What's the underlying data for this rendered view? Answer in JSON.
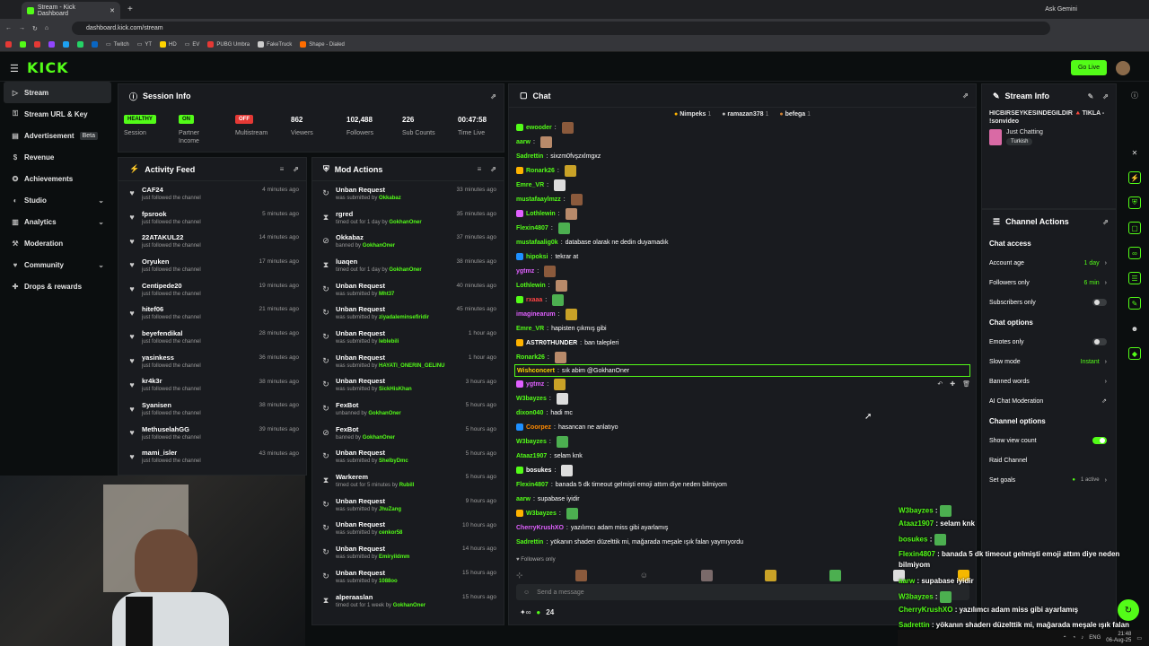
{
  "browser": {
    "tab_title": "Stream - Kick Dashboard",
    "url": "dashboard.kick.com/stream",
    "ask_gemini": "Ask Gemini",
    "bookmarks": [
      "Twitch",
      "YT",
      "HD",
      "EV",
      "PUBG Umbra",
      "FakeTruck",
      "Shape - Dialed"
    ]
  },
  "app": {
    "logo": "KICK",
    "go_live": "Go Live"
  },
  "sidebar": {
    "items": [
      {
        "label": "Stream",
        "icon": "▷"
      },
      {
        "label": "Stream URL & Key",
        "icon": "⚿"
      },
      {
        "label": "Advertisement",
        "icon": "▤",
        "badge": "Beta"
      },
      {
        "label": "Revenue",
        "icon": "$"
      },
      {
        "label": "Achievements",
        "icon": "✪"
      },
      {
        "label": "Studio",
        "icon": "◐",
        "chevron": "⌄"
      },
      {
        "label": "Analytics",
        "icon": "▥",
        "chevron": "⌄"
      },
      {
        "label": "Moderation",
        "icon": "⚒"
      },
      {
        "label": "Community",
        "icon": "♥",
        "chevron": "⌄"
      },
      {
        "label": "Drops & rewards",
        "icon": "✚"
      }
    ]
  },
  "session": {
    "title": "Session Info",
    "stats": [
      {
        "value": "HEALTHY",
        "label": "Session",
        "color": "#53fc18"
      },
      {
        "value": "ON",
        "label": "Partner Income",
        "color": "#53fc18"
      },
      {
        "value": "OFF",
        "label": "Multistream",
        "color": "#e53935"
      },
      {
        "value": "862",
        "label": "Viewers"
      },
      {
        "value": "102,488",
        "label": "Followers"
      },
      {
        "value": "226",
        "label": "Sub Counts"
      },
      {
        "value": "00:47:58",
        "label": "Time Live"
      }
    ]
  },
  "activity": {
    "title": "Activity Feed",
    "items": [
      {
        "name": "CAF24",
        "desc": "just followed the channel",
        "time": "4 minutes ago"
      },
      {
        "name": "fpsrook",
        "desc": "just followed the channel",
        "time": "5 minutes ago"
      },
      {
        "name": "22ATAKUL22",
        "desc": "just followed the channel",
        "time": "14 minutes ago"
      },
      {
        "name": "Oryuken",
        "desc": "just followed the channel",
        "time": "17 minutes ago"
      },
      {
        "name": "Centipede20",
        "desc": "just followed the channel",
        "time": "19 minutes ago"
      },
      {
        "name": "hitef06",
        "desc": "just followed the channel",
        "time": "21 minutes ago"
      },
      {
        "name": "beyefendikal",
        "desc": "just followed the channel",
        "time": "28 minutes ago"
      },
      {
        "name": "yasinkess",
        "desc": "just followed the channel",
        "time": "36 minutes ago"
      },
      {
        "name": "kr4k3r",
        "desc": "just followed the channel",
        "time": "38 minutes ago"
      },
      {
        "name": "Syanisen",
        "desc": "just followed the channel",
        "time": "38 minutes ago"
      },
      {
        "name": "MethuselahGG",
        "desc": "just followed the channel",
        "time": "39 minutes ago"
      },
      {
        "name": "mami_isler",
        "desc": "just followed the channel",
        "time": "43 minutes ago"
      }
    ]
  },
  "mod": {
    "title": "Mod Actions",
    "items": [
      {
        "icon": "↻",
        "title": "Unban Request",
        "desc": "was submitted by",
        "who": "Okkabaz",
        "time": "33 minutes ago"
      },
      {
        "icon": "⧗",
        "title": "rgred",
        "desc": "timed out for 1 day by",
        "who": "GokhanOner",
        "time": "35 minutes ago"
      },
      {
        "icon": "⊘",
        "title": "Okkabaz",
        "desc": "banned by",
        "who": "GokhanOner",
        "time": "37 minutes ago"
      },
      {
        "icon": "⧗",
        "title": "luaqen",
        "desc": "timed out for 1 day by",
        "who": "GokhanOner",
        "time": "38 minutes ago"
      },
      {
        "icon": "↻",
        "title": "Unban Request",
        "desc": "was submitted by",
        "who": "Mht37",
        "time": "40 minutes ago"
      },
      {
        "icon": "↻",
        "title": "Unban Request",
        "desc": "was submitted by",
        "who": "ziyadaleminsefiridir",
        "time": "45 minutes ago"
      },
      {
        "icon": "↻",
        "title": "Unban Request",
        "desc": "was submitted by",
        "who": "leblebili",
        "time": "1 hour ago"
      },
      {
        "icon": "↻",
        "title": "Unban Request",
        "desc": "was submitted by",
        "who": "HAYATI_ONERIN_GELINU",
        "time": "1 hour ago"
      },
      {
        "icon": "↻",
        "title": "Unban Request",
        "desc": "was submitted by",
        "who": "SickHisKhan",
        "time": "3 hours ago"
      },
      {
        "icon": "↻",
        "title": "FexBot",
        "desc": "unbanned by",
        "who": "GokhanOner",
        "time": "5 hours ago"
      },
      {
        "icon": "⊘",
        "title": "FexBot",
        "desc": "banned by",
        "who": "GokhanOner",
        "time": "5 hours ago"
      },
      {
        "icon": "↻",
        "title": "Unban Request",
        "desc": "was submitted by",
        "who": "ShelbyDmc",
        "time": "5 hours ago"
      },
      {
        "icon": "⧗",
        "title": "Warkerem",
        "desc": "timed out for 5 minutes by",
        "who": "Rubill",
        "time": "5 hours ago"
      },
      {
        "icon": "↻",
        "title": "Unban Request",
        "desc": "was submitted by",
        "who": "JhuZang",
        "time": "9 hours ago"
      },
      {
        "icon": "↻",
        "title": "Unban Request",
        "desc": "was submitted by",
        "who": "cenkor58",
        "time": "10 hours ago"
      },
      {
        "icon": "↻",
        "title": "Unban Request",
        "desc": "was submitted by",
        "who": "Emiryildmm",
        "time": "14 hours ago"
      },
      {
        "icon": "↻",
        "title": "Unban Request",
        "desc": "was submitted by",
        "who": "1088oo",
        "time": "15 hours ago"
      },
      {
        "icon": "⧗",
        "title": "alperaaslan",
        "desc": "timed out for 1 week by",
        "who": "GokhanOner",
        "time": "15 hours ago"
      }
    ]
  },
  "chat": {
    "title": "Chat",
    "top_gifters": [
      {
        "name": "Nimpeks",
        "count": "1"
      },
      {
        "name": "ramazan378",
        "count": "1"
      },
      {
        "name": "befega",
        "count": "1"
      }
    ],
    "messages": [
      {
        "user": "ewooder",
        "color": "#53fc18",
        "text": ""
      },
      {
        "user": "aarw",
        "color": "#53fc18",
        "text": ""
      },
      {
        "user": "Sadrettin",
        "color": "#53fc18",
        "text": "sixzm0fvşzxlmgxz"
      },
      {
        "user": "Ronark26",
        "color": "#53fc18",
        "text": ""
      },
      {
        "user": "Emre_VR",
        "color": "#53fc18",
        "text": ""
      },
      {
        "user": "mustafaaylmzz",
        "color": "#53fc18",
        "text": ""
      },
      {
        "user": "Lothlewin",
        "color": "#53fc18",
        "text": ""
      },
      {
        "user": "Flexin4807",
        "color": "#53fc18",
        "text": ""
      },
      {
        "user": "mustafaalig0k",
        "color": "#53fc18",
        "text": "database olarak ne dedin duyamadık"
      },
      {
        "user": "hipoksi",
        "color": "#53fc18",
        "text": "tekrar at"
      },
      {
        "user": "ygtmz",
        "color": "#e060ff",
        "text": ""
      },
      {
        "user": "Lothlewin",
        "color": "#53fc18",
        "text": ""
      },
      {
        "user": "rxaaa",
        "color": "#ff4444",
        "text": ""
      },
      {
        "user": "imaginearum",
        "color": "#e060ff",
        "text": ""
      },
      {
        "user": "Emre_VR",
        "color": "#53fc18",
        "text": "hapisten çıkmış gibi"
      },
      {
        "user": "ASTR0THUNDER",
        "color": "#ffffff",
        "text": "ban talepleri"
      },
      {
        "user": "Ronark26",
        "color": "#53fc18",
        "text": ""
      },
      {
        "user": "Wishconcert",
        "color": "#ffd400",
        "text": "sık abim @GokhanOner"
      },
      {
        "user": "ygtmz",
        "color": "#e060ff",
        "text": ""
      },
      {
        "user": "W3bayzes",
        "color": "#53fc18",
        "text": ""
      },
      {
        "user": "dixon040",
        "color": "#53fc18",
        "text": "hadi mc"
      },
      {
        "user": "Coorpez",
        "color": "#ff8a00",
        "text": "hasancan ne anlatıyo"
      },
      {
        "user": "W3bayzes",
        "color": "#53fc18",
        "text": ""
      },
      {
        "user": "Ataaz1907",
        "color": "#53fc18",
        "text": "selam knk"
      },
      {
        "user": "bosukes",
        "color": "#ffffff",
        "text": ""
      },
      {
        "user": "Flexin4807",
        "color": "#53fc18",
        "text": "banada 5 dk timeout gelmişti emoji attım diye neden bilmiyom"
      },
      {
        "user": "aarw",
        "color": "#53fc18",
        "text": "supabase iyidir"
      },
      {
        "user": "W3bayzes",
        "color": "#53fc18",
        "text": ""
      },
      {
        "user": "CherryKrushXO",
        "color": "#e060ff",
        "text": "yazılımcı adam miss gibi ayarlamış"
      },
      {
        "user": "Sadrettin",
        "color": "#53fc18",
        "text": "yökanın shaderı düzelttik mi, mağarada meşale ışık falan yaymıyordu"
      }
    ],
    "followers_only": "Followers only",
    "input_placeholder": "Send a message",
    "points": "24"
  },
  "stream_info": {
    "title": "Stream Info",
    "stream_title": "HICBIRSEYKESINDEGILDIR 🔺TIKLA - !sonvideo",
    "category": "Just Chatting",
    "language": "Turkish"
  },
  "channel_actions": {
    "title": "Channel Actions",
    "chat_access": "Chat access",
    "account_age": {
      "label": "Account age",
      "value": "1 day"
    },
    "followers_only": {
      "label": "Followers only",
      "value": "6 min"
    },
    "subscribers_only": "Subscribers only",
    "chat_options": "Chat options",
    "emotes_only": "Emotes only",
    "slow_mode": {
      "label": "Slow mode",
      "value": "Instant"
    },
    "banned_words": "Banned words",
    "ai_moderation": "AI Chat Moderation",
    "channel_options": "Channel options",
    "show_view_count": "Show view count",
    "raid_channel": "Raid Channel",
    "set_goals": {
      "label": "Set goals",
      "value": "1 active"
    }
  },
  "overlay_chat": [
    {
      "user": "W3bayzes",
      "text": ""
    },
    {
      "user": "Ataaz1907",
      "text": "selam knk"
    },
    {
      "user": "bosukes",
      "text": ""
    },
    {
      "user": "Flexin4807",
      "text": "banada 5 dk timeout gelmişti emoji attım diye neden bilmiyom"
    },
    {
      "user": "aarw",
      "text": "supabase iyidir"
    },
    {
      "user": "W3bayzes",
      "text": ""
    },
    {
      "user": "CherryKrushXO",
      "text": "yazılımcı adam miss gibi ayarlamış"
    },
    {
      "user": "Sadrettin",
      "text": "yökanın shaderı düzelttik mi, mağarada meşale ışık falan yaymıyordu"
    }
  ],
  "taskbar": {
    "lang": "ENG",
    "time": "21:48",
    "date": "06-Aug-25"
  }
}
